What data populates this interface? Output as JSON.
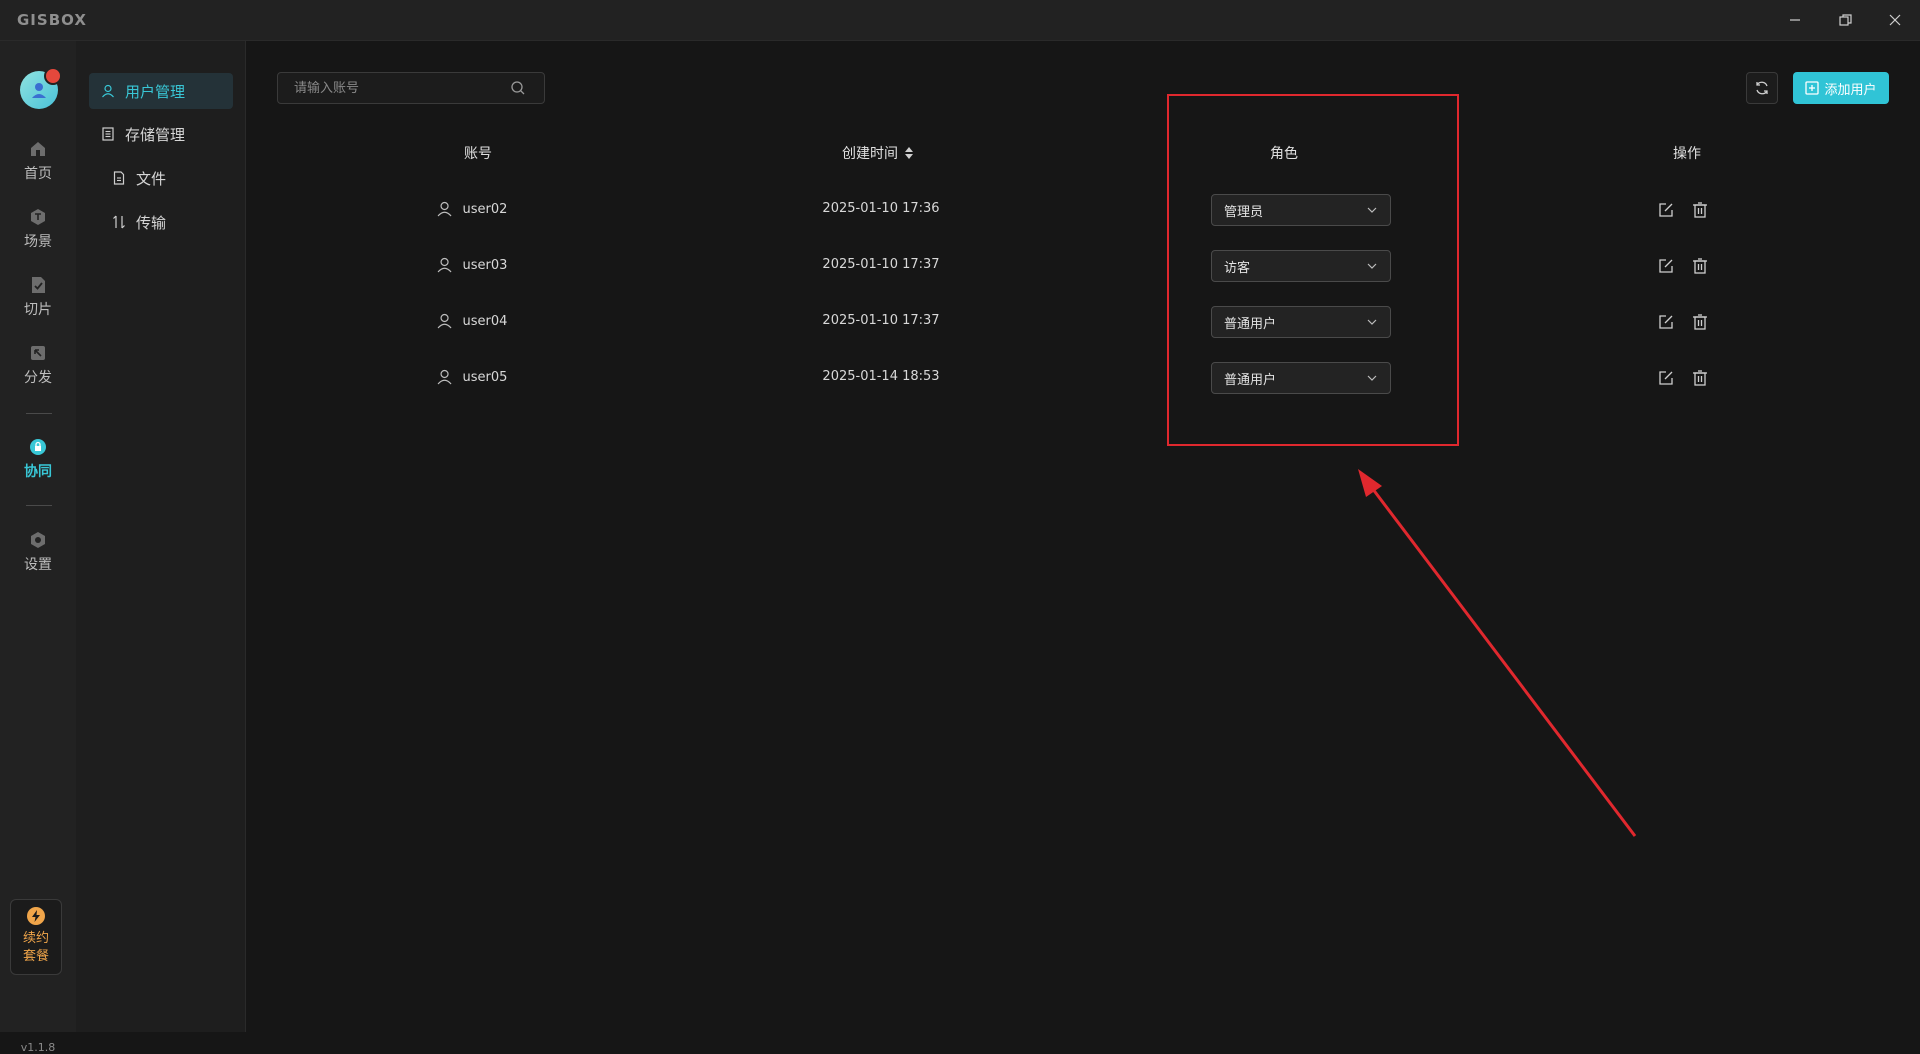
{
  "app": {
    "logo_text": "GISBOX",
    "version": "v1.1.8"
  },
  "window_controls": {
    "minimize": "—",
    "restore": "❐",
    "close": "✕"
  },
  "rail": {
    "items": [
      {
        "label": "首页",
        "icon": "home-icon"
      },
      {
        "label": "场景",
        "icon": "scene-icon"
      },
      {
        "label": "切片",
        "icon": "tile-icon"
      },
      {
        "label": "分发",
        "icon": "distribute-icon"
      },
      {
        "label": "协同",
        "icon": "collaborate-icon",
        "active": true
      },
      {
        "label": "设置",
        "icon": "settings-icon"
      }
    ],
    "renew_label": "续约套餐"
  },
  "submenu": {
    "items": [
      {
        "label": "用户管理",
        "icon": "user-icon",
        "active": true
      },
      {
        "label": "存储管理",
        "icon": "storage-icon"
      },
      {
        "label": "文件",
        "icon": "file-icon"
      },
      {
        "label": "传输",
        "icon": "transfer-icon"
      }
    ]
  },
  "toolbar": {
    "search_placeholder": "请输入账号",
    "add_user_label": "添加用户"
  },
  "table": {
    "columns": {
      "account": "账号",
      "created": "创建时间",
      "role": "角色",
      "actions": "操作"
    },
    "rows": [
      {
        "account": "user02",
        "created": "2025-01-10 17:36",
        "role": "管理员"
      },
      {
        "account": "user03",
        "created": "2025-01-10 17:37",
        "role": "访客"
      },
      {
        "account": "user04",
        "created": "2025-01-10 17:37",
        "role": "普通用户"
      },
      {
        "account": "user05",
        "created": "2025-01-14 18:53",
        "role": "普通用户"
      }
    ]
  },
  "colors": {
    "accent": "#30c4d6",
    "annotation": "#e0282e",
    "renew": "#f0a54a"
  }
}
